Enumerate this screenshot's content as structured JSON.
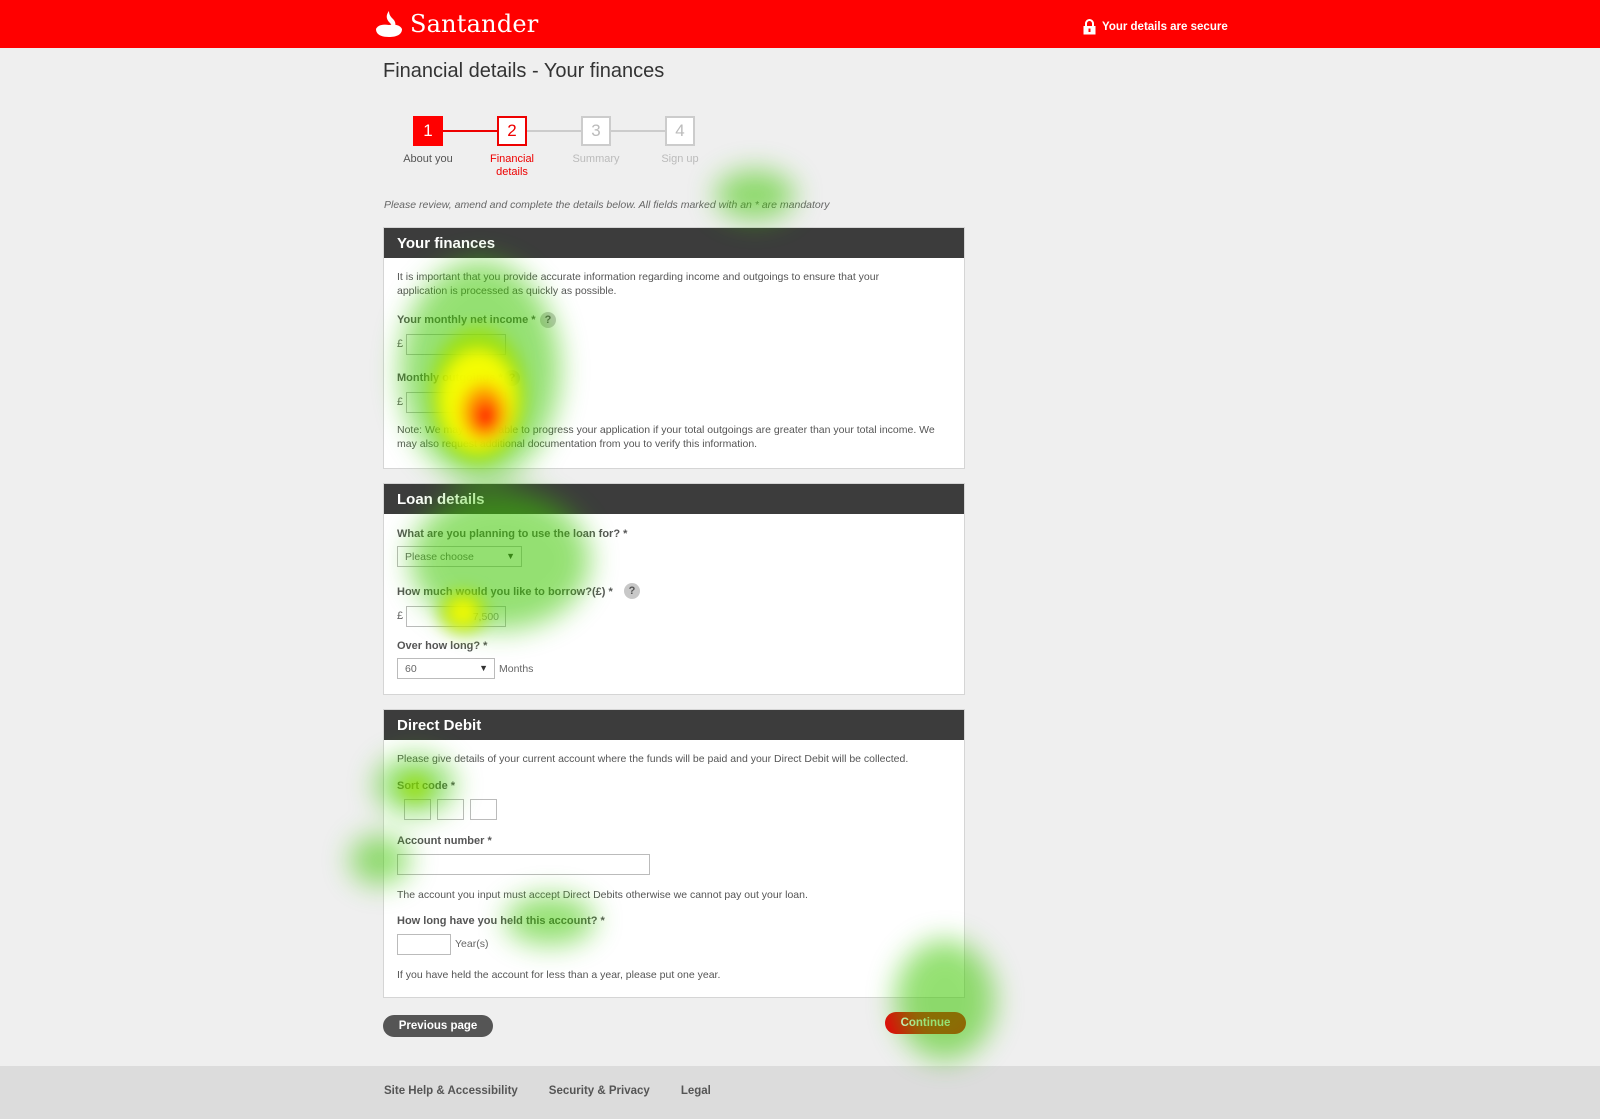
{
  "header": {
    "brand": "Santander",
    "secure_text": "Your details are secure",
    "icons": {
      "logo": "santander-flame-icon",
      "lock": "lock-icon"
    },
    "colors": {
      "brand_red": "#ff0000",
      "dark_header": "#3c3c3c"
    }
  },
  "page_title": "Financial details - Your finances",
  "steps": [
    {
      "number": "1",
      "label": "About you",
      "state": "done"
    },
    {
      "number": "2",
      "label": "Financial details",
      "state": "current"
    },
    {
      "number": "3",
      "label": "Summary",
      "state": "upcoming"
    },
    {
      "number": "4",
      "label": "Sign up",
      "state": "upcoming"
    }
  ],
  "instructions": "Please review, amend and complete the details below. All fields marked with an * are mandatory",
  "finances": {
    "title": "Your finances",
    "intro": "It is important that you provide accurate information regarding income and outgoings to ensure that your application is processed as quickly as possible.",
    "income_label": "Your monthly net income *",
    "income_currency": "£",
    "outgoings_label": "Monthly outgoings *",
    "outgoings_currency": "£",
    "note": "Note: We may not be able to progress your application if your total outgoings are greater than your total income. We may also request additional documentation from you to verify this information.",
    "help": "?"
  },
  "loan": {
    "title": "Loan details",
    "purpose_label": "What are you planning to use the loan for? *",
    "purpose_value": "Please choose",
    "amount_label": "How much would you like to borrow?(£) *",
    "amount_currency": "£",
    "amount_value": "7,500",
    "term_label": "Over how long? *",
    "term_value": "60",
    "term_unit": "Months",
    "help": "?"
  },
  "direct_debit": {
    "title": "Direct Debit",
    "intro": "Please give details of your current account where the funds will be paid and your Direct Debit will be collected.",
    "sort_code_label": "Sort code *",
    "account_label": "Account number *",
    "account_note": "The account you input must accept Direct Debits otherwise we cannot pay out your loan.",
    "held_label": "How long have you held this account? *",
    "held_unit": "Year(s)",
    "held_note": "If you have held the account for less than a year, please put one year."
  },
  "buttons": {
    "previous": "Previous page",
    "continue": "Continue"
  },
  "footer": {
    "links": [
      "Site Help & Accessibility",
      "Security & Privacy",
      "Legal"
    ]
  },
  "heatmap_overlay": {
    "colors": {
      "low": "#3cc800",
      "mid": "#ffff00",
      "high": "#ff0000"
    }
  }
}
